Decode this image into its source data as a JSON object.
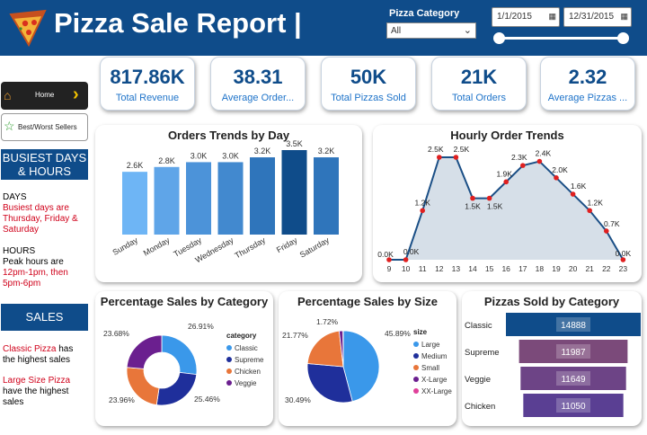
{
  "header": {
    "title": "Pizza Sale Report |",
    "category_label": "Pizza Category",
    "category_value": "All",
    "date_start": "1/1/2015",
    "date_end": "12/31/2015"
  },
  "nav": {
    "home_label": "Home",
    "best_worst_label": "Best/Worst Sellers"
  },
  "kpis": [
    {
      "value": "817.86K",
      "label": "Total Revenue"
    },
    {
      "value": "38.31",
      "label": "Average Order..."
    },
    {
      "value": "50K",
      "label": "Total Pizzas Sold"
    },
    {
      "value": "21K",
      "label": "Total Orders"
    },
    {
      "value": "2.32",
      "label": "Average Pizzas ..."
    }
  ],
  "sidebar": {
    "busy_heading": "BUSIEST DAYS & HOURS",
    "days_label": "DAYS",
    "days_text": "Busiest days are Thursday, Friday & Saturday",
    "hours_label": "HOURS",
    "hours_text1": "Peak hours are",
    "hours_text2": "12pm-1pm, then 5pm-6pm",
    "sales_heading": "SALES",
    "sales_text1_red": "Classic Pizza",
    "sales_text1": " has the highest sales",
    "sales_text2_red": "Large Size Pizza",
    "sales_text2": " have the highest sales"
  },
  "chart_data": [
    {
      "type": "bar",
      "title": "Orders Trends by Day",
      "categories": [
        "Sunday",
        "Monday",
        "Tuesday",
        "Wednesday",
        "Thursday",
        "Friday",
        "Saturday"
      ],
      "values": [
        2.6,
        2.8,
        3.0,
        3.0,
        3.2,
        3.5,
        3.2
      ],
      "labels": [
        "2.6K",
        "2.8K",
        "3.0K",
        "3.0K",
        "3.2K",
        "3.5K",
        "3.2K"
      ],
      "colors": [
        "#6eb5f5",
        "#5fa5e8",
        "#4c93d9",
        "#4289cf",
        "#2f75bb",
        "#0f4c8a",
        "#2f75bb"
      ],
      "ylim": [
        0,
        3.5
      ]
    },
    {
      "type": "area",
      "title": "Hourly Order Trends",
      "x": [
        9,
        10,
        11,
        12,
        13,
        14,
        15,
        16,
        17,
        18,
        19,
        20,
        21,
        22,
        23
      ],
      "values": [
        0.0,
        0.0,
        1.2,
        2.5,
        2.5,
        1.5,
        1.5,
        1.9,
        2.3,
        2.4,
        2.0,
        1.6,
        1.2,
        0.7,
        0.0
      ],
      "labels": [
        "0.0K",
        "0.0K",
        "1.2K",
        "2.5K",
        "2.5K",
        "1.5K",
        "1.5K",
        "1.9K",
        "2.3K",
        "2.4K",
        "2.0K",
        "1.6K",
        "1.2K",
        "0.7K",
        "0.0K"
      ],
      "ylim": [
        0,
        2.5
      ]
    },
    {
      "type": "pie",
      "title": "Percentage Sales by Category",
      "legend_title": "category",
      "categories": [
        "Classic",
        "Supreme",
        "Chicken",
        "Veggie"
      ],
      "values": [
        26.91,
        25.46,
        23.96,
        23.68
      ],
      "labels": [
        "26.91%",
        "25.46%",
        "23.96%",
        "23.68%"
      ],
      "colors": [
        "#3a98ea",
        "#1f2f9b",
        "#e8763a",
        "#6b1f8f"
      ]
    },
    {
      "type": "pie",
      "title": "Percentage Sales by Size",
      "legend_title": "size",
      "categories": [
        "Large",
        "Medium",
        "Small",
        "X-Large",
        "XX-Large"
      ],
      "values": [
        45.89,
        30.49,
        21.77,
        1.72,
        0.12
      ],
      "labels": [
        "45.89%",
        "30.49%",
        "21.77%",
        "1.72%",
        ""
      ],
      "colors": [
        "#3a98ea",
        "#1f2f9b",
        "#e8763a",
        "#6b1f8f",
        "#e0409a"
      ]
    },
    {
      "type": "bar",
      "title": "Pizzas Sold by Category",
      "categories": [
        "Classic",
        "Supreme",
        "Veggie",
        "Chicken"
      ],
      "values": [
        14888,
        11987,
        11649,
        11050
      ],
      "labels": [
        "14888",
        "11987",
        "11649",
        "11050"
      ],
      "colors": [
        "#0f4c8a",
        "#7b4a7a",
        "#6d4486",
        "#5a3f93"
      ]
    }
  ]
}
